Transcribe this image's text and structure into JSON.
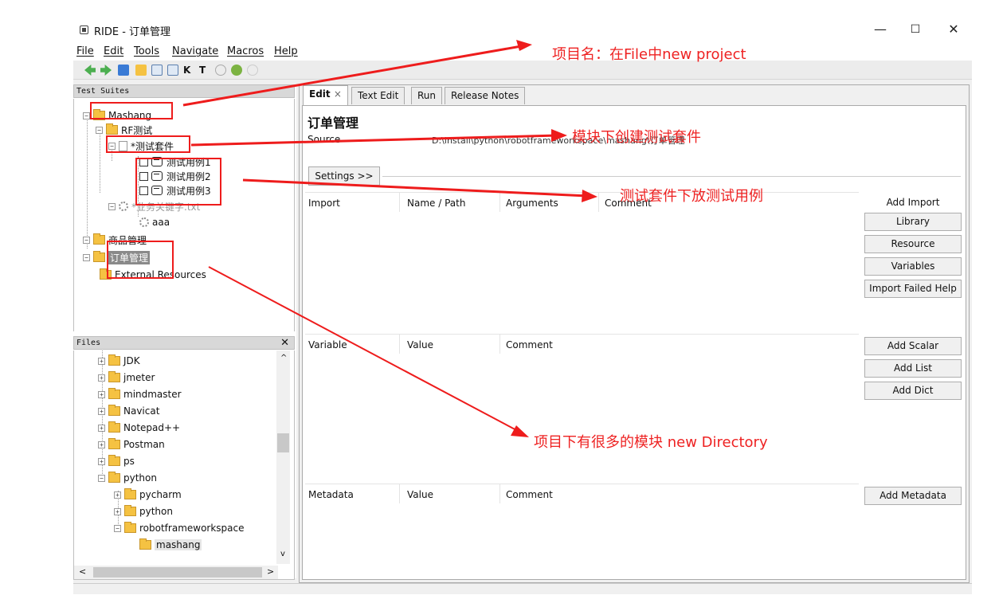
{
  "window": {
    "title": "RIDE - 订单管理",
    "controls": {
      "minimize": "—",
      "maximize": "☐",
      "close": "✕"
    }
  },
  "menu": [
    "File",
    "Edit",
    "Tools",
    "Navigate",
    "Macros",
    "Help"
  ],
  "toolbar": [
    "back-icon",
    "forward-icon",
    "save-icon",
    "folder-icon",
    "new-file-icon",
    "new-file-2-icon",
    "keyword-icon",
    "test-icon",
    "run-icon",
    "debug-icon",
    "stop-icon"
  ],
  "test_suites": {
    "header": "Test Suites",
    "project": "Mashang",
    "module": "RF测试",
    "suite": "*测试套件",
    "cases": [
      "测试用例1",
      "测试用例2",
      "测试用例3"
    ],
    "resource_file": "*业务关键字.txt",
    "keyword": "aaa",
    "module2": "商品管理",
    "module3": "订单管理",
    "external": "External Resources"
  },
  "files": {
    "header": "Files",
    "close": "✕",
    "items": [
      "JDK",
      "jmeter",
      "mindmaster",
      "Navicat",
      "Notepad++",
      "Postman",
      "ps",
      "python",
      "pycharm",
      "python",
      "robotframeworkspace",
      "mashang"
    ]
  },
  "tabs": [
    "Edit",
    "Text Edit",
    "Run",
    "Release Notes"
  ],
  "tab_close": "×",
  "editor": {
    "title": "订单管理",
    "source_label": "Source",
    "source_value": "D:\\install\\python\\robotframeworkspace\\mashang\\订单管理",
    "settings_button": "Settings >>",
    "import_headers": [
      "Import",
      "Name / Path",
      "Arguments",
      "Comment"
    ],
    "variable_headers": [
      "Variable",
      "Value",
      "Comment"
    ],
    "metadata_headers": [
      "Metadata",
      "Value",
      "Comment"
    ],
    "import_label": "Add Import",
    "import_buttons": [
      "Library",
      "Resource",
      "Variables",
      "Import Failed Help"
    ],
    "variable_buttons": [
      "Add Scalar",
      "Add List",
      "Add Dict"
    ],
    "metadata_button": "Add Metadata"
  },
  "annotations": {
    "project": "项目名：在File中new project",
    "suite": "模块下创建测试套件",
    "cases": "测试套件下放测试用例",
    "modules": "项目下有很多的模块 new Directory"
  },
  "colors": {
    "annotation": "#ee2222",
    "folder": "#f5c242"
  }
}
